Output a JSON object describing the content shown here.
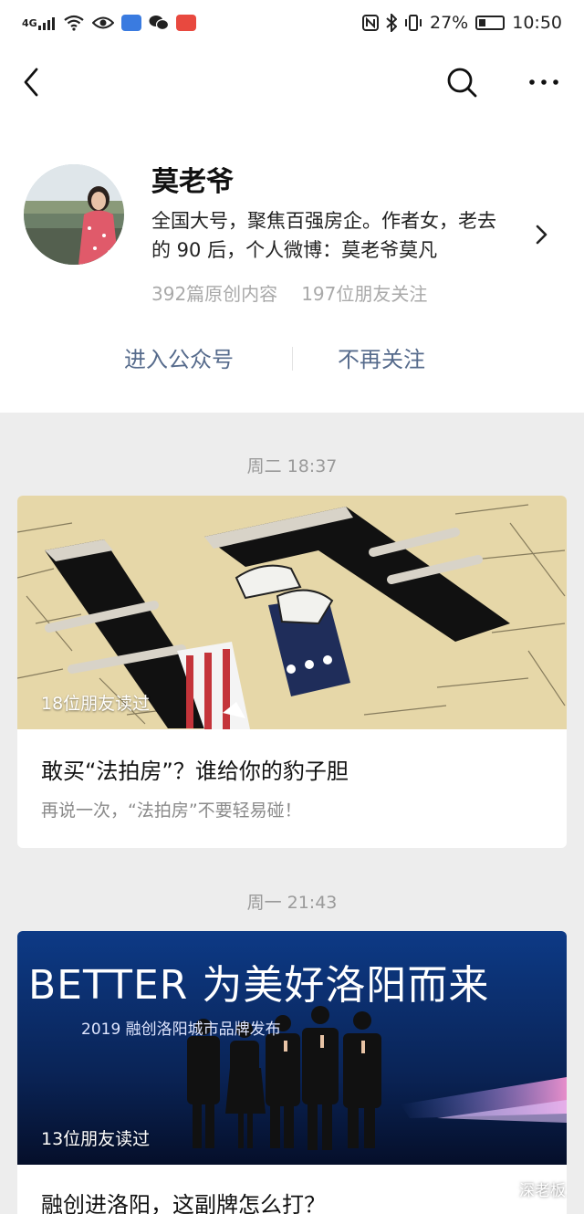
{
  "status_bar": {
    "network": "4G",
    "battery": "27%",
    "battery_level": 0.27,
    "time": "10:50",
    "icons": [
      "signal-icon",
      "wifi-icon",
      "eye-icon",
      "app-icon",
      "wechat-icon",
      "app-icon",
      "nfc-icon",
      "bluetooth-icon",
      "vibrate-icon",
      "battery-icon"
    ]
  },
  "nav": {
    "icons": [
      "back-icon",
      "search-icon",
      "more-icon"
    ]
  },
  "profile": {
    "name": "莫老爷",
    "desc_line1": "全国大号，聚焦百强房企。作者女，老去",
    "desc_line2": "的 90 后，个人微博：莫老爷莫凡",
    "stat_articles": "392篇原创内容",
    "stat_followers": "197位朋友关注",
    "enter_label": "进入公众号",
    "unfollow_label": "不再关注",
    "link_color": "#566b8c"
  },
  "articles": [
    {
      "time": "周二 18:37",
      "readers": "18位朋友读过",
      "title": "敢买“法拍房”？谁给你的豹子胆",
      "subtitle": "再说一次，“法拍房”不要轻易碰！"
    },
    {
      "time": "周一 21:43",
      "readers": "13位朋友读过",
      "title": "融创进洛阳，这副牌怎么打？",
      "image_text_1": "BETTER 为美好洛阳而来",
      "image_text_2": "2019 融创洛阳城市品牌发布"
    }
  ],
  "watermark": "深老板"
}
